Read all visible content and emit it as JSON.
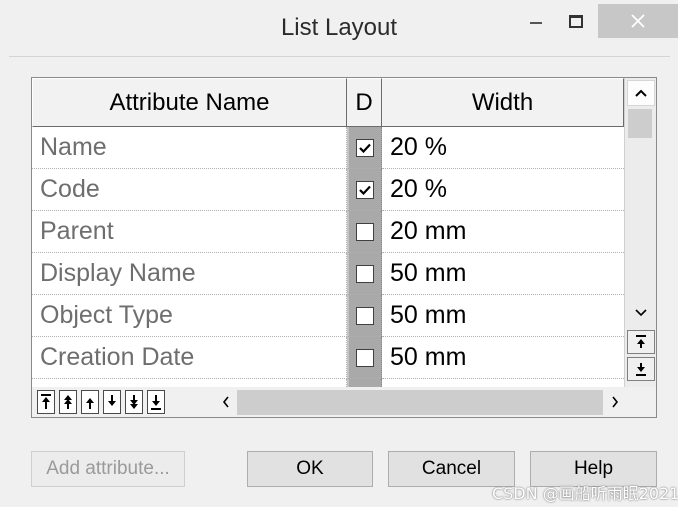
{
  "window": {
    "title": "List Layout",
    "buttons": [
      "minimize-icon",
      "maximize-icon",
      "close-icon"
    ],
    "close_hover_color": "#c7c7c7"
  },
  "grid": {
    "columns": [
      "Attribute Name",
      "D",
      "Width"
    ],
    "rows": [
      {
        "name": "Name",
        "displayed": true,
        "width": "20 %"
      },
      {
        "name": "Code",
        "displayed": true,
        "width": "20 %"
      },
      {
        "name": "Parent",
        "displayed": false,
        "width": "20 mm"
      },
      {
        "name": "Display Name",
        "displayed": false,
        "width": "50 mm"
      },
      {
        "name": "Object Type",
        "displayed": false,
        "width": "50 mm"
      },
      {
        "name": "Creation Date",
        "displayed": false,
        "width": "50 mm"
      }
    ],
    "move_toolbar": [
      "move-to-top-icon",
      "move-up-page-icon",
      "move-up-icon",
      "move-down-icon",
      "move-down-page-icon",
      "move-to-bottom-icon"
    ],
    "colors": {
      "display_column_bg": "#a9a9a9",
      "name_text": "#6e6e6e"
    }
  },
  "buttons": {
    "add": "Add attribute...",
    "ok": "OK",
    "cancel": "Cancel",
    "help": "Help"
  },
  "watermark": "CSDN @画船听雨眠2021"
}
